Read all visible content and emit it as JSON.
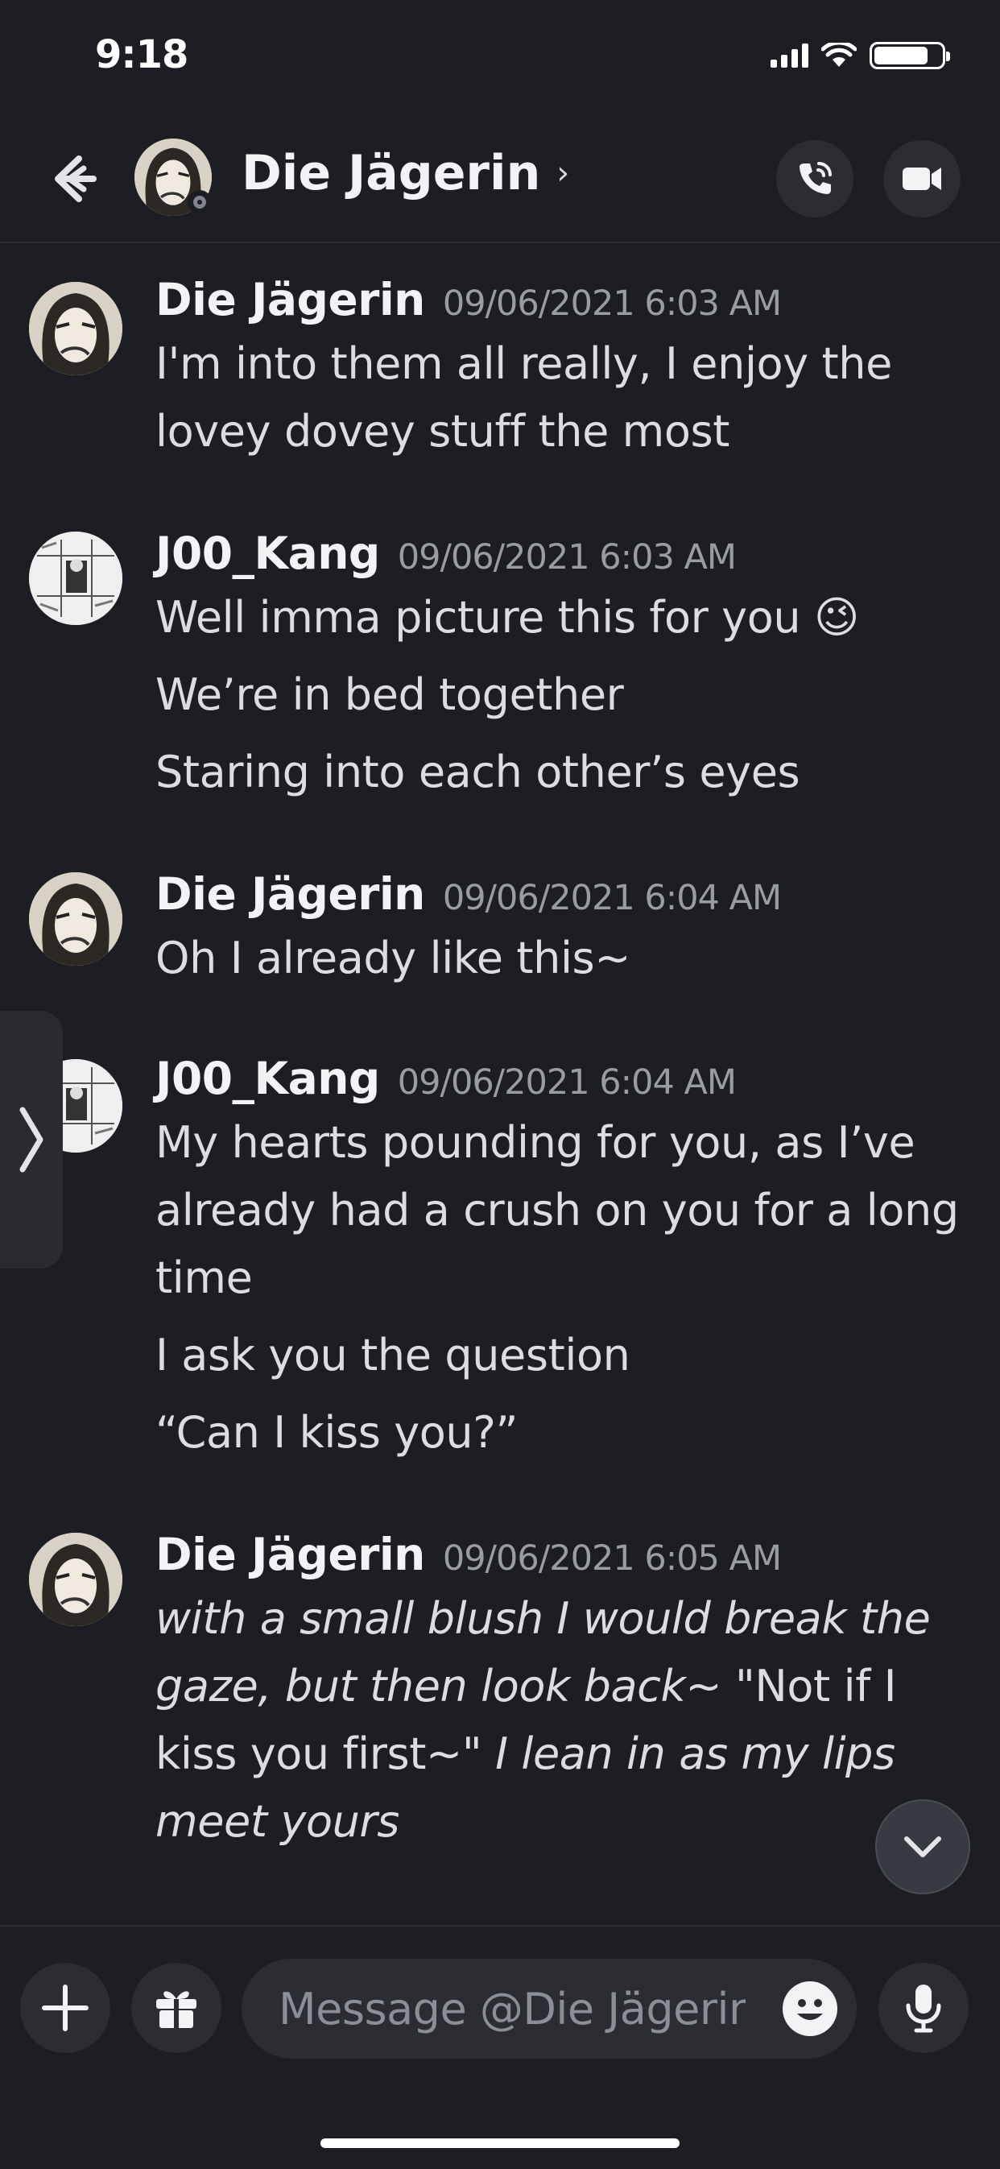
{
  "status_bar": {
    "time": "9:18",
    "battery_level": 0.8
  },
  "header": {
    "contact_name": "Die Jägerin",
    "chevron": "›"
  },
  "messages": [
    {
      "author": "Die Jägerin",
      "timestamp": "09/06/2021 6:03 AM",
      "lines": [
        "I'm into them all really, I enjoy the lovey dovey stuff the most"
      ]
    },
    {
      "author": "J00_Kang",
      "timestamp": "09/06/2021 6:03 AM",
      "lines": [
        "Well imma picture this for you",
        "We’re in bed together",
        "Staring into each other’s eyes"
      ],
      "emoji": "😉"
    },
    {
      "author": "Die Jägerin",
      "timestamp": "09/06/2021 6:04 AM",
      "lines": [
        "Oh I already like this~"
      ]
    },
    {
      "author": "J00_Kang",
      "timestamp": "09/06/2021 6:04 AM",
      "lines": [
        "My hearts pounding for you, as I’ve already had a crush on you for a long time",
        "I ask you the question",
        "“Can I kiss you?”"
      ]
    },
    {
      "author": "Die Jägerin",
      "timestamp": "09/06/2021 6:05 AM",
      "parts": [
        {
          "text": "with a small blush I would break the gaze, but then look back~",
          "italic": true
        },
        {
          "text": " \"Not if I kiss you first~\" ",
          "italic": false
        },
        {
          "text": "I lean in as my lips meet yours",
          "italic": true
        }
      ]
    }
  ],
  "composer": {
    "placeholder": "Message @Die Jägerin"
  },
  "icons": {
    "back": "back-arrow-icon",
    "call": "phone-icon",
    "video": "video-camera-icon",
    "plus": "plus-icon",
    "gift": "gift-icon",
    "emoji": "emoji-face-icon",
    "mic": "microphone-icon",
    "scroll_down": "chevron-down-icon",
    "drawer": "chevron-right-icon"
  }
}
